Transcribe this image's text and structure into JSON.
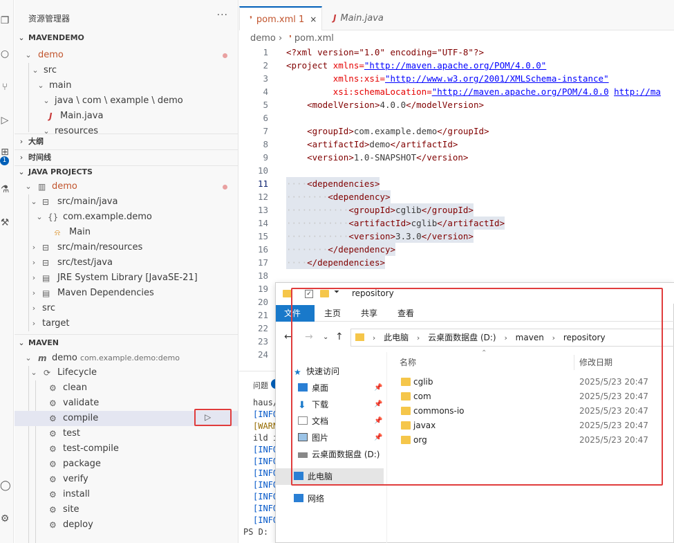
{
  "activity_bar": {
    "icons": [
      "explorer-icon",
      "search-icon",
      "source-control-icon",
      "run-debug-icon",
      "extensions-icon",
      "testing-icon",
      "remote-icon",
      "accounts-icon",
      "settings-icon"
    ],
    "extensions_badge": "1"
  },
  "sidebar": {
    "title": "资源管理器",
    "more": "···",
    "sections": {
      "mavendemo": "MAVENDEMO",
      "outline": "大纲",
      "timeline": "时间线",
      "java_projects": "JAVA PROJECTS",
      "maven": "MAVEN"
    },
    "tree": [
      {
        "label": "demo"
      },
      {
        "label": "src"
      },
      {
        "label": "main"
      },
      {
        "label": "java \\ com \\ example \\ demo"
      },
      {
        "label": "Main.java"
      },
      {
        "label": "resources"
      }
    ],
    "java_projects": [
      {
        "label": "demo"
      },
      {
        "label": "src/main/java"
      },
      {
        "label": "com.example.demo"
      },
      {
        "label": "Main"
      },
      {
        "label": "src/main/resources"
      },
      {
        "label": "src/test/java"
      },
      {
        "label": "JRE System Library [JavaSE-21]"
      },
      {
        "label": "Maven Dependencies"
      },
      {
        "label": "src"
      },
      {
        "label": "target"
      }
    ],
    "maven": {
      "project": "demo",
      "project_id": "com.example.demo:demo",
      "lifecycle": "Lifecycle",
      "phases": [
        "clean",
        "validate",
        "compile",
        "test",
        "test-compile",
        "package",
        "verify",
        "install",
        "site",
        "deploy"
      ],
      "selected_phase": "compile"
    }
  },
  "editor": {
    "tabs": [
      {
        "label": "pom.xml",
        "badge": "1",
        "close": "×"
      },
      {
        "label": "Main.java"
      }
    ],
    "breadcrumb": [
      "demo",
      "pom.xml"
    ],
    "lines": [
      {
        "n": "1"
      },
      {
        "n": "2"
      },
      {
        "n": "3"
      },
      {
        "n": "4"
      },
      {
        "n": "5"
      },
      {
        "n": "6"
      },
      {
        "n": "7"
      },
      {
        "n": "8"
      },
      {
        "n": "9"
      },
      {
        "n": "10"
      },
      {
        "n": "11"
      },
      {
        "n": "12"
      },
      {
        "n": "13"
      },
      {
        "n": "14"
      },
      {
        "n": "15"
      },
      {
        "n": "16"
      },
      {
        "n": "17"
      },
      {
        "n": "18"
      },
      {
        "n": "19"
      },
      {
        "n": "20"
      },
      {
        "n": "21"
      },
      {
        "n": "22"
      },
      {
        "n": "23"
      },
      {
        "n": "24"
      }
    ],
    "code": {
      "l1_decl": "<?xml version=\"1.0\" encoding=\"UTF-8\"?>",
      "project_tag": "<project",
      "xmlns_attr": "xmlns=",
      "xmlns_val": "\"http://maven.apache.org/POM/4.0.0\"",
      "xmlns_xsi_attr": "xmlns:xsi=",
      "xmlns_xsi_val": "\"http://www.w3.org/2001/XMLSchema-instance\"",
      "schema_attr": "xsi:schemaLocation=",
      "schema_val1": "\"http://maven.apache.org/POM/4.0.0",
      "schema_val2": "http://ma",
      "model_open": "<modelVersion>",
      "model_val": "4.0.0",
      "model_close": "</modelVersion>",
      "group_open": "<groupId>",
      "group_val": "com.example.demo",
      "group_close": "</groupId>",
      "artifact_open": "<artifactId>",
      "artifact_val": "demo",
      "artifact_close": "</artifactId>",
      "version_open": "<version>",
      "version_val": "1.0-SNAPSHOT",
      "version_close": "</version>",
      "deps_open": "<dependencies>",
      "dep_open": "<dependency>",
      "dep_group_val": "cglib",
      "dep_artifact_val": "cglib",
      "dep_version_val": "3.3.0",
      "dep_close": "</dependency>",
      "deps_close": "</dependencies>"
    }
  },
  "panel": {
    "title": "问题",
    "terminal": [
      {
        "text": "haus/"
      },
      {
        "text": "[INFO"
      },
      {
        "text": "[WARN"
      },
      {
        "text": "ild i"
      },
      {
        "text": "[INFO"
      },
      {
        "text": "[INFO"
      },
      {
        "text": "[INFO"
      },
      {
        "text": "[INFO"
      },
      {
        "text": "[INFO"
      },
      {
        "text": "[INFO"
      },
      {
        "text": "[INFO"
      },
      {
        "text": "PS D:"
      }
    ]
  },
  "explorer_window": {
    "title": "repository",
    "ribbon_tabs": [
      "文件",
      "主页",
      "共享",
      "查看"
    ],
    "address": [
      "此电脑",
      "云桌面数据盘 (D:)",
      "maven",
      "repository"
    ],
    "nav": [
      {
        "label": "快速访问"
      },
      {
        "label": "桌面"
      },
      {
        "label": "下载"
      },
      {
        "label": "文档"
      },
      {
        "label": "图片"
      },
      {
        "label": "云桌面数据盘 (D:)"
      },
      {
        "label": "此电脑"
      },
      {
        "label": "网络"
      }
    ],
    "columns": {
      "name": "名称",
      "date": "修改日期"
    },
    "folders": [
      {
        "name": "cglib",
        "date": "2025/5/23 20:47"
      },
      {
        "name": "com",
        "date": "2025/5/23 20:47"
      },
      {
        "name": "commons-io",
        "date": "2025/5/23 20:47"
      },
      {
        "name": "javax",
        "date": "2025/5/23 20:47"
      },
      {
        "name": "org",
        "date": "2025/5/23 20:47"
      }
    ]
  },
  "colors": {
    "accent": "#005fb8",
    "highlight_box": "#e03c3c",
    "folder": "#f5c64a",
    "modified_orange": "#c1542d"
  }
}
